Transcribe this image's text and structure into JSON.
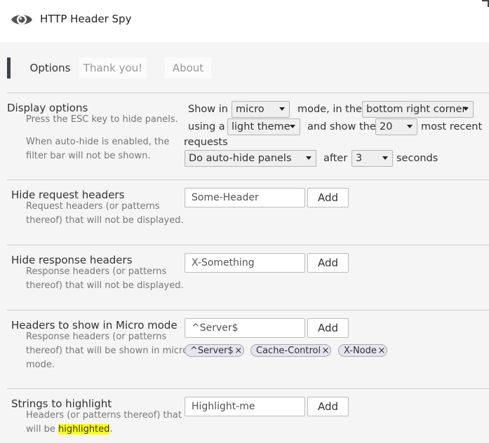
{
  "app": {
    "title": "HTTP Header Spy",
    "icon": "eye-icon"
  },
  "tabs": [
    {
      "label": "Options",
      "active": true
    },
    {
      "label": "Thank you!",
      "active": false
    },
    {
      "label": "About",
      "active": false
    }
  ],
  "display": {
    "title": "Display options",
    "desc1": "Press the ESC key to hide panels.",
    "desc2_line1": "When auto-hide is enabled, the",
    "desc2_line2": "filter bar will not be shown.",
    "show_in": "Show in",
    "mode_value": "micro",
    "mode_in_the": "mode, in the",
    "corner_value": "bottom right corner",
    "using_a": "using a",
    "theme_value": "light theme",
    "and_show_the": "and show the",
    "count_value": "20",
    "most_recent": "most recent",
    "requests": "requests",
    "autohide_value": "Do auto-hide panels",
    "after": "after",
    "seconds_value": "3",
    "seconds": "seconds"
  },
  "hide_request": {
    "title": "Hide request headers",
    "desc_line1": "Request headers (or patterns",
    "desc_line2": "thereof) that will not be displayed.",
    "placeholder": "Some-Header",
    "add_label": "Add"
  },
  "hide_response": {
    "title": "Hide response headers",
    "desc_line1": "Response headers (or patterns",
    "desc_line2": "thereof) that will not be displayed.",
    "placeholder": "X-Something",
    "add_label": "Add"
  },
  "micro": {
    "title": "Headers to show in Micro mode",
    "desc_line1": "Response headers (or patterns",
    "desc_line2": "thereof) that will be shown in micro",
    "desc_line3": "mode.",
    "placeholder": "^Server$",
    "add_label": "Add",
    "tags": [
      "^Server$",
      "Cache-Control",
      "X-Node"
    ],
    "remove_glyph": "×"
  },
  "highlight": {
    "title": "Strings to highlight",
    "desc_line1": "Headers (or patterns thereof) that",
    "desc_line2_prefix": "will be",
    "desc_highlighted": "highlighted",
    "desc_suffix": ".",
    "placeholder": "Highlight-me",
    "add_label": "Add"
  }
}
